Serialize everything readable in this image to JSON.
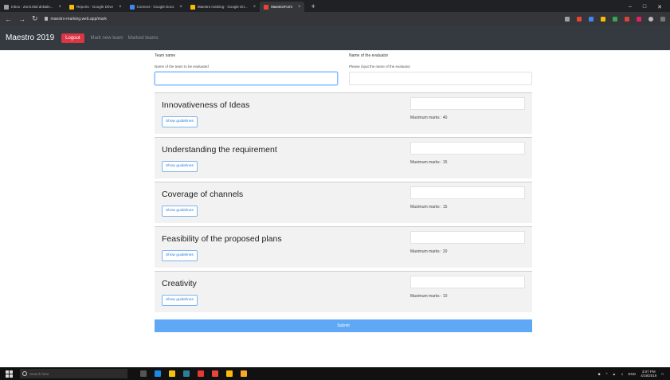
{
  "browser": {
    "tabs": [
      {
        "label": "Inbox - Zomi.Mal deb&le...",
        "color": "#9aa0a6",
        "active": false
      },
      {
        "label": "Reports - Google Drive",
        "color": "#fbbc04",
        "active": false
      },
      {
        "label": "Connect - Google Docs",
        "color": "#4285f4",
        "active": false
      },
      {
        "label": "Maestro marking - Google Dri...",
        "color": "#fbbc04",
        "active": false
      },
      {
        "label": "MaestroForm",
        "color": "#ea4335",
        "active": true
      }
    ],
    "new_tab": "+",
    "url": "maestro-marking.web.app/mark",
    "window_controls": [
      "–",
      "□",
      "✕"
    ]
  },
  "navbar": {
    "brand": "Maestro 2019",
    "logout": "Logout",
    "links": [
      "Mark new team",
      "Marked teams"
    ]
  },
  "form": {
    "team_label": "Team name",
    "team_help": "Name of the team to be evaluated",
    "evaluator_label": "Name of the evaluator",
    "evaluator_help": "Please input the name of the evaluator",
    "criteria": [
      {
        "title": "Innovativeness of Ideas",
        "guide": "Show guidelines",
        "max": "Maximum marks : 40"
      },
      {
        "title": "Understanding the requirement",
        "guide": "Show guidelines",
        "max": "Maximum marks : 15"
      },
      {
        "title": "Coverage of channels",
        "guide": "Show guidelines",
        "max": "Maximum marks : 15"
      },
      {
        "title": "Feasibility of the proposed plans",
        "guide": "Show guidelines",
        "max": "Maximum marks : 20"
      },
      {
        "title": "Creativity",
        "guide": "Show guidelines",
        "max": "Maximum marks : 10"
      }
    ],
    "submit": "Submit"
  },
  "taskbar": {
    "search_placeholder": "Search here",
    "time": "3:07 PM",
    "date": "4/19/2019",
    "lang": "ENG"
  }
}
